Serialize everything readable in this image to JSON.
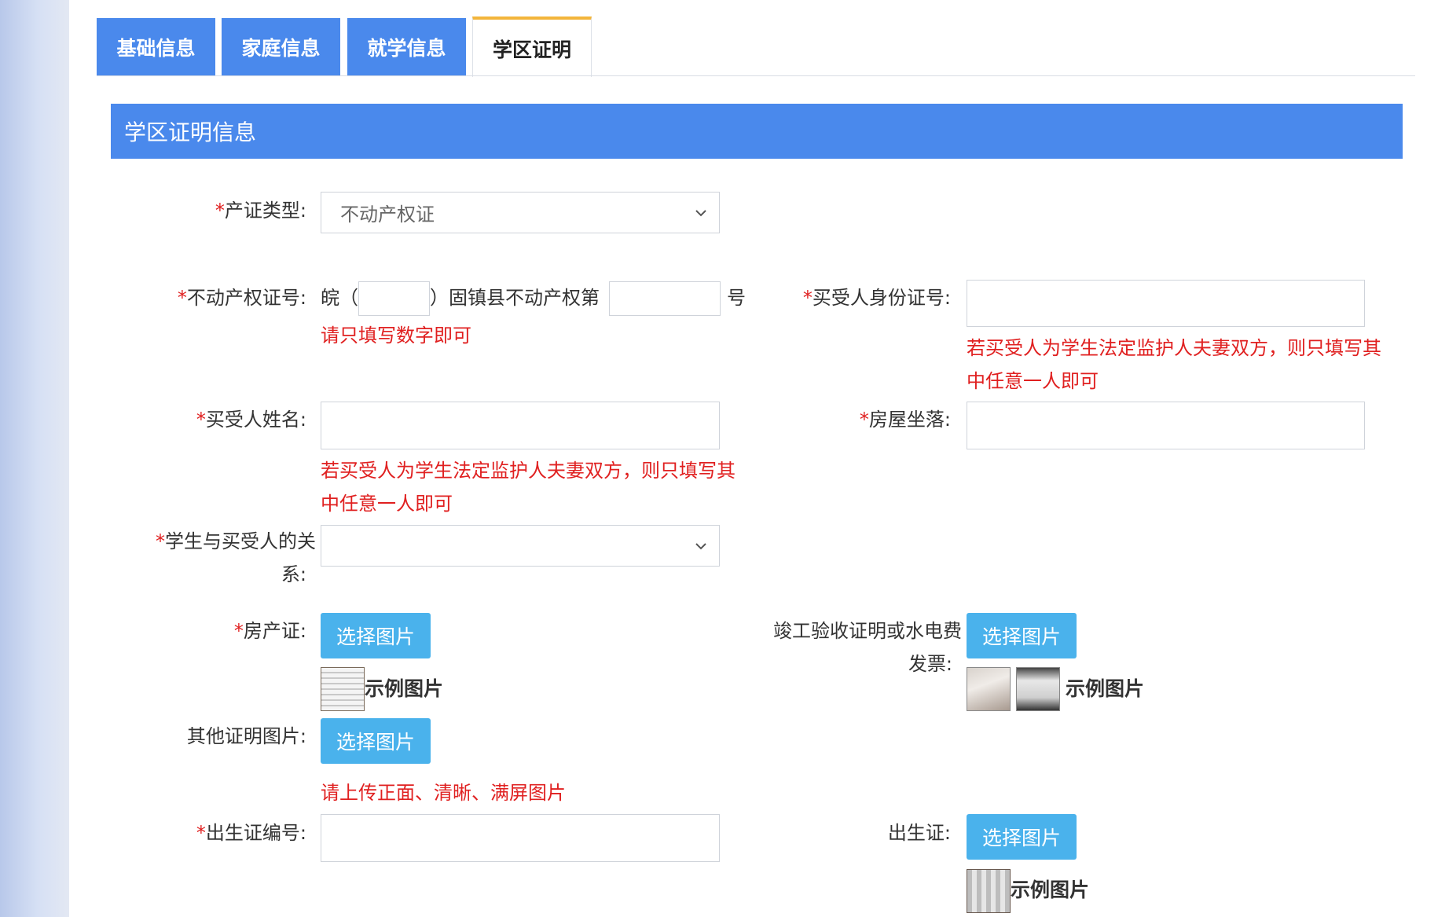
{
  "tabs": [
    {
      "label": "基础信息"
    },
    {
      "label": "家庭信息"
    },
    {
      "label": "就学信息"
    },
    {
      "label": "学区证明"
    }
  ],
  "section": {
    "title": "学区证明信息"
  },
  "form": {
    "required_mark": "*",
    "cert_type": {
      "label": "产证类型:",
      "value": "不动产权证"
    },
    "cert_no": {
      "label": "不动产权证号:",
      "prefix": "皖（",
      "middle": "）固镇县不动产权第",
      "suffix": "号",
      "hint": "请只填写数字即可"
    },
    "buyer_id": {
      "label": "买受人身份证号:",
      "hint_line1": "若买受人为学生法定监护人夫妻双方，则只填写其",
      "hint_line2": "中任意一人即可"
    },
    "buyer_name": {
      "label": "买受人姓名:",
      "hint_line1": "若买受人为学生法定监护人夫妻双方，则只填写其",
      "hint_line2": "中任意一人即可"
    },
    "house_location": {
      "label": "房屋坐落:"
    },
    "relation": {
      "label_line1": "学生与买受人的关",
      "label_line2": "系:",
      "value": ""
    },
    "house_cert": {
      "label": "房产证:",
      "button": "选择图片",
      "sample": "示例图片"
    },
    "completion_cert": {
      "label_line1": "竣工验收证明或水电费",
      "label_line2": "发票:",
      "button": "选择图片",
      "sample": "示例图片"
    },
    "other_cert": {
      "label": "其他证明图片:",
      "button": "选择图片",
      "hint": "请上传正面、清晰、满屏图片"
    },
    "birth_no": {
      "label": "出生证编号:"
    },
    "birth_cert": {
      "label": "出生证:",
      "button": "选择图片",
      "sample": "示例图片"
    }
  }
}
